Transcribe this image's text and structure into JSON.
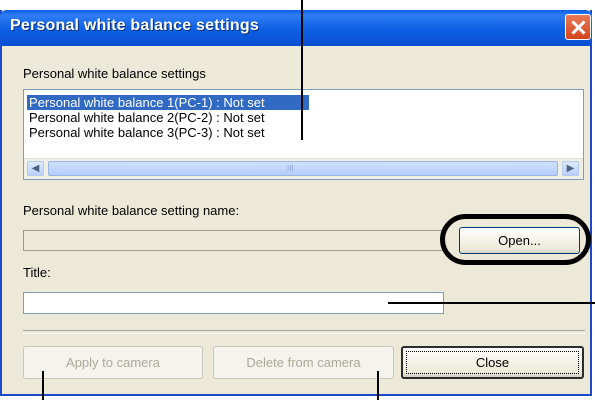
{
  "window": {
    "title": "Personal white balance settings"
  },
  "list_section": {
    "label": "Personal white balance settings",
    "items": [
      {
        "text": "Personal white balance 1(PC-1) : Not set",
        "selected": true
      },
      {
        "text": "Personal white balance 2(PC-2) : Not set",
        "selected": false
      },
      {
        "text": "Personal white balance 3(PC-3) : Not set",
        "selected": false
      }
    ]
  },
  "setting_name": {
    "label": "Personal white balance setting name:",
    "value": ""
  },
  "title_field": {
    "label": "Title:",
    "value": ""
  },
  "buttons": {
    "open": "Open...",
    "apply": "Apply to camera",
    "delete": "Delete from camera",
    "close": "Close"
  },
  "icons": {
    "window_close": "close-x-icon",
    "scroll_left": "arrow-left-icon",
    "scroll_right": "arrow-right-icon"
  },
  "colors": {
    "titlebar": "#0a5ee6",
    "selection": "#316ac5",
    "dialog": "#ece9d8",
    "close_button": "#d2441d"
  }
}
